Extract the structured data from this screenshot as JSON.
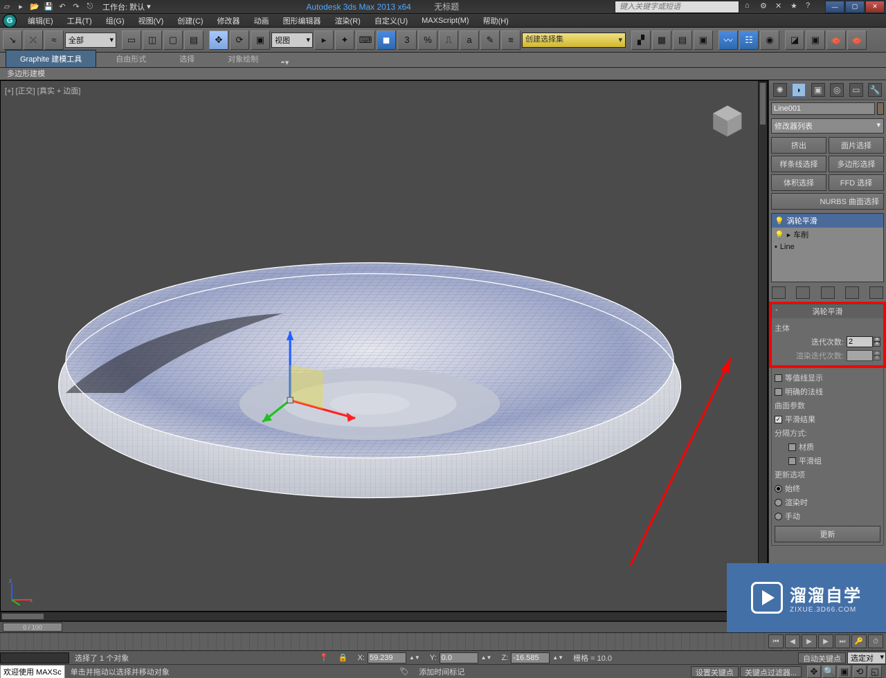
{
  "title": {
    "workspace_label": "工作台: 默认",
    "app": "Autodesk 3ds Max  2013 x64",
    "untitled": "无标题",
    "search_placeholder": "键入关键字或短语"
  },
  "menu": {
    "edit": "编辑(E)",
    "tools": "工具(T)",
    "group": "组(G)",
    "views": "视图(V)",
    "create": "创建(C)",
    "modifiers": "修改器",
    "animation": "动画",
    "graph": "图形编辑器",
    "rendering": "渲染(R)",
    "custom": "自定义(U)",
    "maxscript": "MAXScript(M)",
    "help": "帮助(H)"
  },
  "toolbar": {
    "dd_all": "全部",
    "dd_view": "视图",
    "snap_angle": "3",
    "selset_placeholder": "创建选择集"
  },
  "ribbon": {
    "tab1": "Graphite 建模工具",
    "tab2": "自由形式",
    "tab3": "选择",
    "tab4": "对象绘制",
    "subtab": "多边形建模"
  },
  "viewport": {
    "label": "[+] [正交] [真实 + 边面]"
  },
  "sidepanel": {
    "object_name": "Line001",
    "modlist_label": "修改器列表",
    "mod_btns": {
      "extrude": "挤出",
      "face_sel": "面片选择",
      "spline_sel": "样条线选择",
      "poly_sel": "多边形选择",
      "vol_sel": "体积选择",
      "ffd": "FFD 选择",
      "nurbs": "NURBS 曲面选择"
    },
    "stack": {
      "turbosmooth": "涡轮平滑",
      "lathe": "车削",
      "line": "Line"
    }
  },
  "rollout": {
    "name": "涡轮平滑",
    "group_main": "主体",
    "iterations_label": "迭代次数:",
    "iterations_value": "2",
    "render_iter_label": "渲染迭代次数:",
    "isoline": "等值线显示",
    "explicit_normals": "明确的法线",
    "surface_params": "曲面参数",
    "smooth_result": "平滑结果",
    "separate_by": "分隔方式:",
    "material": "材质",
    "smooth_group": "平滑组",
    "update_opts": "更新选项",
    "always": "始终",
    "when_render": "渲染时",
    "manual": "手动",
    "update_btn": "更新"
  },
  "timeline": {
    "pos": "0 / 100"
  },
  "status": {
    "sel": "选择了 1 个对象",
    "x_label": "X:",
    "x_val": "59.239",
    "y_label": "Y:",
    "y_val": "0.0",
    "z_label": "Z:",
    "z_val": "-16.585",
    "grid": "栅格 = 10.0",
    "autokey": "自动关键点",
    "selkey": "选定对",
    "welcome": "欢迎使用  MAXSc",
    "tooltip": "单击并拖动以选择并移动对象",
    "add_time": "添加时间标记",
    "setkey": "设置关键点",
    "keyfilter": "关键点过滤器..."
  },
  "watermark": {
    "big": "溜溜自学",
    "small": "ZIXUE.3D66.COM"
  }
}
